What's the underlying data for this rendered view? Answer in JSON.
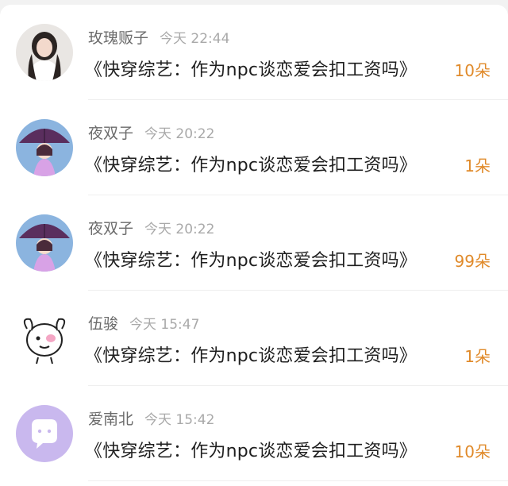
{
  "comments": [
    {
      "user": "玫瑰贩子",
      "time": "今天 22:44",
      "text": "《快穿综艺：作为npc谈恋爱会扣工资吗》",
      "gifts": "10朵",
      "avatar": "woman-photo"
    },
    {
      "user": "夜双子",
      "time": "今天 20:22",
      "text": "《快穿综艺：作为npc谈恋爱会扣工资吗》",
      "gifts": "1朵",
      "avatar": "anime-girl-umbrella"
    },
    {
      "user": "夜双子",
      "time": "今天 20:22",
      "text": "《快穿综艺：作为npc谈恋爱会扣工资吗》",
      "gifts": "99朵",
      "avatar": "anime-girl-umbrella"
    },
    {
      "user": "伍骏",
      "time": "今天 15:47",
      "text": "《快穿综艺：作为npc谈恋爱会扣工资吗》",
      "gifts": "1朵",
      "avatar": "cartoon-dog"
    },
    {
      "user": "爱南北",
      "time": "今天 15:42",
      "text": "《快穿综艺：作为npc谈恋爱会扣工资吗》",
      "gifts": "10朵",
      "avatar": "default-chat-bubble"
    }
  ],
  "colors": {
    "gift": "#e08a2a",
    "name": "#6b6b6b",
    "time": "#a9a9a9",
    "default_avatar": "#c9b8ee"
  }
}
